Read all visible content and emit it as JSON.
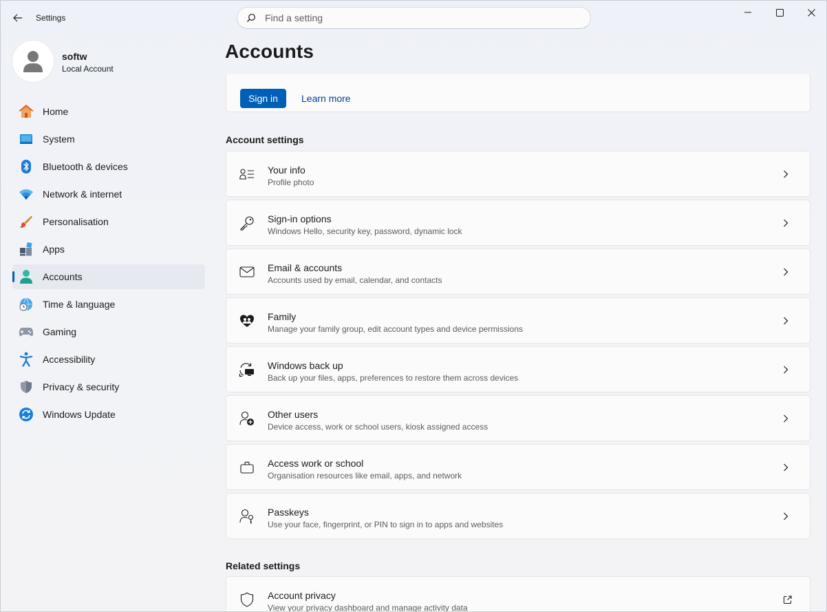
{
  "app": {
    "title": "Settings"
  },
  "search": {
    "placeholder": "Find a setting"
  },
  "profile": {
    "name": "softw",
    "account_type": "Local Account"
  },
  "sidebar": {
    "items": [
      {
        "label": "Home",
        "icon": "home-icon"
      },
      {
        "label": "System",
        "icon": "system-icon"
      },
      {
        "label": "Bluetooth & devices",
        "icon": "bluetooth-icon"
      },
      {
        "label": "Network & internet",
        "icon": "wifi-icon"
      },
      {
        "label": "Personalisation",
        "icon": "brush-icon"
      },
      {
        "label": "Apps",
        "icon": "apps-icon"
      },
      {
        "label": "Accounts",
        "icon": "accounts-icon",
        "active": true
      },
      {
        "label": "Time & language",
        "icon": "globe-clock-icon"
      },
      {
        "label": "Gaming",
        "icon": "gamepad-icon"
      },
      {
        "label": "Accessibility",
        "icon": "accessibility-icon"
      },
      {
        "label": "Privacy & security",
        "icon": "shield-icon"
      },
      {
        "label": "Windows Update",
        "icon": "update-icon"
      }
    ]
  },
  "main": {
    "page_title": "Accounts",
    "banner": {
      "signin_label": "Sign in",
      "learn_more_label": "Learn more"
    },
    "account_settings_title": "Account settings",
    "rows": [
      {
        "title": "Your info",
        "subtitle": "Profile photo",
        "icon": "person-list-icon"
      },
      {
        "title": "Sign-in options",
        "subtitle": "Windows Hello, security key, password, dynamic lock",
        "icon": "key-icon"
      },
      {
        "title": "Email & accounts",
        "subtitle": "Accounts used by email, calendar, and contacts",
        "icon": "mail-icon"
      },
      {
        "title": "Family",
        "subtitle": "Manage your family group, edit account types and device permissions",
        "icon": "family-heart-icon"
      },
      {
        "title": "Windows back up",
        "subtitle": "Back up your files, apps, preferences to restore them across devices",
        "icon": "backup-icon"
      },
      {
        "title": "Other users",
        "subtitle": "Device access, work or school users, kiosk assigned access",
        "icon": "person-add-icon"
      },
      {
        "title": "Access work or school",
        "subtitle": "Organisation resources like email, apps, and network",
        "icon": "briefcase-icon"
      },
      {
        "title": "Passkeys",
        "subtitle": "Use your face, fingerprint, or PIN to sign in to apps and websites",
        "icon": "passkey-icon"
      }
    ],
    "related_settings_title": "Related settings",
    "related_rows": [
      {
        "title": "Account privacy",
        "subtitle": "View your privacy dashboard and manage activity data",
        "icon": "shield-outline-icon"
      }
    ]
  },
  "colors": {
    "accent": "#005fb8",
    "link": "#003e92"
  }
}
